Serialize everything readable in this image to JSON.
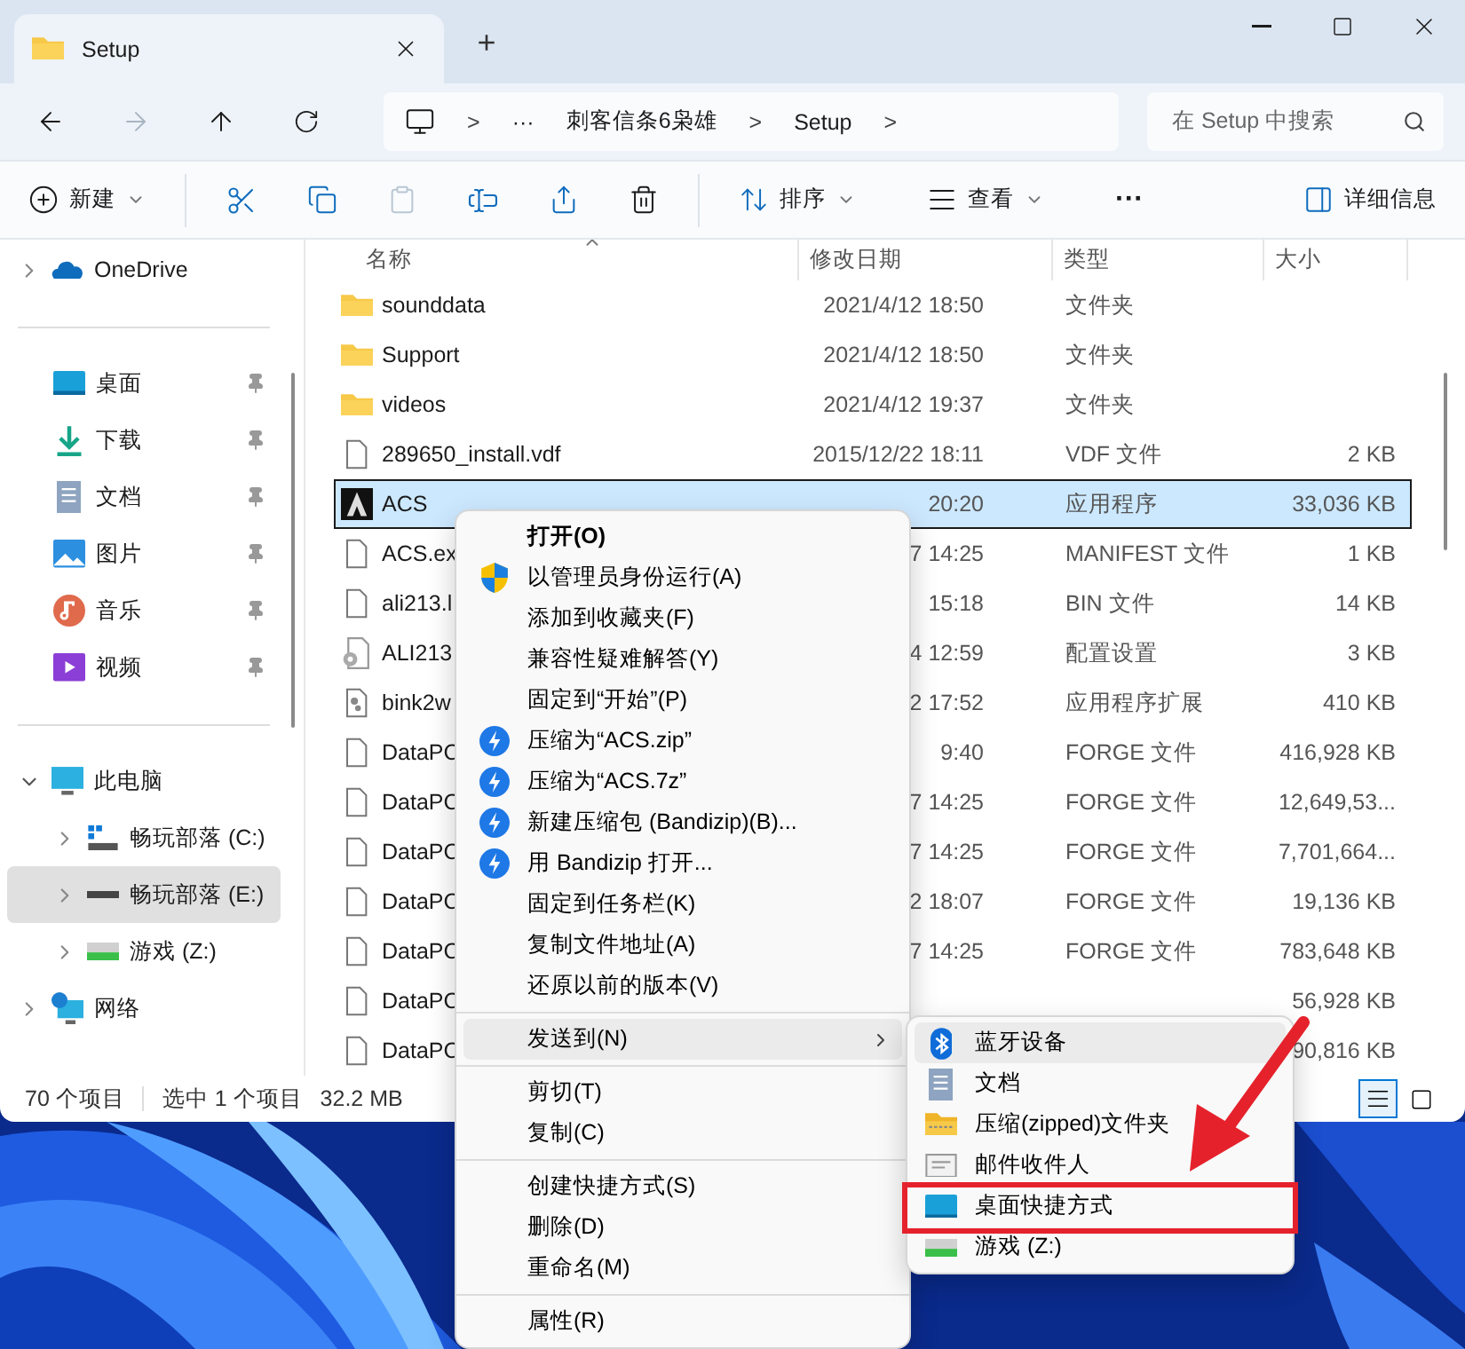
{
  "window": {
    "tab_title": "Setup",
    "new_tab": "+"
  },
  "address": {
    "breadcrumbs": [
      {
        "kind": "computer"
      },
      {
        "kind": "sep",
        "text": ">"
      },
      {
        "kind": "text",
        "text": "···"
      },
      {
        "kind": "text",
        "text": "刺客信条6枭雄"
      },
      {
        "kind": "sep",
        "text": ">"
      },
      {
        "kind": "text",
        "text": "Setup"
      },
      {
        "kind": "sep",
        "text": ">"
      }
    ],
    "search": {
      "placeholder": "在 Setup 中搜索"
    }
  },
  "toolbar": {
    "items": [
      {
        "kind": "new",
        "label": "新建",
        "disabled": false
      },
      {
        "kind": "divider"
      },
      {
        "kind": "cut",
        "disabled": false
      },
      {
        "kind": "copy",
        "disabled": false
      },
      {
        "kind": "paste",
        "disabled": true
      },
      {
        "kind": "rename",
        "disabled": false
      },
      {
        "kind": "share",
        "disabled": false
      },
      {
        "kind": "delete",
        "disabled": false
      },
      {
        "kind": "divider"
      },
      {
        "kind": "sort",
        "label": "排序",
        "disabled": false
      },
      {
        "kind": "view",
        "label": "查看",
        "disabled": false
      },
      {
        "kind": "more",
        "label": "···",
        "disabled": false
      }
    ],
    "details": "详细信息"
  },
  "sidebar": {
    "top": [
      {
        "kind": "cloud",
        "label": "OneDrive",
        "expanded": false
      }
    ],
    "quick_access": [
      {
        "kind": "desktop",
        "label": "桌面",
        "pinned": true
      },
      {
        "kind": "download",
        "label": "下载",
        "pinned": true
      },
      {
        "kind": "document",
        "label": "文档",
        "pinned": true
      },
      {
        "kind": "pictures",
        "label": "图片",
        "pinned": true
      },
      {
        "kind": "music",
        "label": "音乐",
        "pinned": true
      },
      {
        "kind": "video",
        "label": "视频",
        "pinned": true
      }
    ],
    "tree": [
      {
        "kind": "pc",
        "label": "此电脑",
        "expanded": true,
        "selected": false,
        "children": [
          {
            "kind": "system-drive",
            "label": "畅玩部落 (C:)",
            "expanded": false,
            "selected": false
          },
          {
            "kind": "drive",
            "label": "畅玩部落 (E:)",
            "expanded": false,
            "selected": true
          },
          {
            "kind": "green-drive",
            "label": "游戏 (Z:)",
            "expanded": false,
            "selected": false
          }
        ]
      },
      {
        "kind": "network",
        "label": "网络",
        "expanded": false,
        "selected": false
      }
    ]
  },
  "file_list": {
    "columns": [
      "名称",
      "修改日期",
      "类型",
      "大小"
    ],
    "rows": [
      {
        "kind": "folder",
        "name": "sounddata",
        "date": "2021/4/12 18:50",
        "type": "文件夹",
        "selected": false
      },
      {
        "kind": "folder",
        "name": "Support",
        "date": "2021/4/12 18:50",
        "type": "文件夹",
        "selected": false
      },
      {
        "kind": "folder",
        "name": "videos",
        "date": "2021/4/12 19:37",
        "type": "文件夹",
        "selected": false
      },
      {
        "kind": "file",
        "name": "289650_install.vdf",
        "date": "2015/12/22 18:11",
        "type": "VDF 文件",
        "size": "2 KB",
        "selected": false
      },
      {
        "kind": "app",
        "name": "ACS",
        "date": "20:20",
        "type": "应用程序",
        "size": "33,036 KB",
        "selected": true
      },
      {
        "kind": "file",
        "name": "ACS.ex",
        "date": "7 14:25",
        "type": "MANIFEST 文件",
        "size": "1 KB",
        "selected": false
      },
      {
        "kind": "file",
        "name": "ali213.l",
        "date": "15:18",
        "type": "BIN 文件",
        "size": "14 KB",
        "selected": false
      },
      {
        "kind": "settings",
        "name": "ALI213",
        "date": "4 12:59",
        "type": "配置设置",
        "size": "3 KB",
        "selected": false
      },
      {
        "kind": "library",
        "name": "bink2w",
        "date": "2 17:52",
        "type": "应用程序扩展",
        "size": "410 KB",
        "selected": false
      },
      {
        "kind": "file",
        "name": "DataPC",
        "date": "9:40",
        "type": "FORGE 文件",
        "size": "416,928 KB",
        "selected": false
      },
      {
        "kind": "file",
        "name": "DataPC",
        "date": "7 14:25",
        "type": "FORGE 文件",
        "size": "12,649,53...",
        "selected": false
      },
      {
        "kind": "file",
        "name": "DataPC",
        "date": "7 14:25",
        "type": "FORGE 文件",
        "size": "7,701,664...",
        "selected": false
      },
      {
        "kind": "file",
        "name": "DataPC",
        "date": "2 18:07",
        "type": "FORGE 文件",
        "size": "19,136 KB",
        "selected": false
      },
      {
        "kind": "file",
        "name": "DataPC",
        "date": "7 14:25",
        "type": "FORGE 文件",
        "size": "783,648 KB",
        "selected": false
      },
      {
        "kind": "file",
        "name": "DataPC",
        "size": "56,928 KB",
        "selected": false
      },
      {
        "kind": "file",
        "name": "DataPC",
        "size": "90,816 KB",
        "selected": false
      }
    ]
  },
  "status_bar": {
    "count": "70 个项目",
    "selection": "选中 1 个项目",
    "size": "32.2 MB",
    "views": [
      {
        "kind": "details",
        "selected": true
      },
      {
        "kind": "tiles",
        "selected": false
      }
    ]
  },
  "context_menu": {
    "items": [
      {
        "kind": "item",
        "label": "打开(O)",
        "default": true
      },
      {
        "kind": "shield",
        "label": "以管理员身份运行(A)"
      },
      {
        "kind": "item",
        "label": "添加到收藏夹(F)"
      },
      {
        "kind": "item",
        "label": "兼容性疑难解答(Y)"
      },
      {
        "kind": "item",
        "label": "固定到“开始”(P)"
      },
      {
        "kind": "bandizip",
        "label": "压缩为“ACS.zip”"
      },
      {
        "kind": "bandizip",
        "label": "压缩为“ACS.7z”"
      },
      {
        "kind": "bandizip",
        "label": "新建压缩包 (Bandizip)(B)..."
      },
      {
        "kind": "bandizip",
        "label": "用 Bandizip 打开..."
      },
      {
        "kind": "item",
        "label": "固定到任务栏(K)"
      },
      {
        "kind": "item",
        "label": "复制文件地址(A)"
      },
      {
        "kind": "item",
        "label": "还原以前的版本(V)"
      },
      {
        "kind": "separator"
      },
      {
        "kind": "submenu",
        "label": "发送到(N)",
        "highlighted": true
      },
      {
        "kind": "separator"
      },
      {
        "kind": "item",
        "label": "剪切(T)"
      },
      {
        "kind": "item",
        "label": "复制(C)"
      },
      {
        "kind": "separator"
      },
      {
        "kind": "item",
        "label": "创建快捷方式(S)"
      },
      {
        "kind": "item",
        "label": "删除(D)"
      },
      {
        "kind": "item",
        "label": "重命名(M)"
      },
      {
        "kind": "separator"
      },
      {
        "kind": "item",
        "label": "属性(R)"
      }
    ]
  },
  "send_to_menu": {
    "items": [
      {
        "kind": "bluetooth",
        "label": "蓝牙设备",
        "highlighted": true,
        "marked": false
      },
      {
        "kind": "document",
        "label": "文档",
        "highlighted": false,
        "marked": false
      },
      {
        "kind": "zip",
        "label": "压缩(zipped)文件夹",
        "highlighted": false,
        "marked": false
      },
      {
        "kind": "mail",
        "label": "邮件收件人",
        "highlighted": false,
        "marked": false
      },
      {
        "kind": "desktop",
        "label": "桌面快捷方式",
        "highlighted": false,
        "marked": true
      },
      {
        "kind": "green-drive",
        "label": "游戏 (Z:)",
        "highlighted": false,
        "marked": false
      }
    ]
  }
}
